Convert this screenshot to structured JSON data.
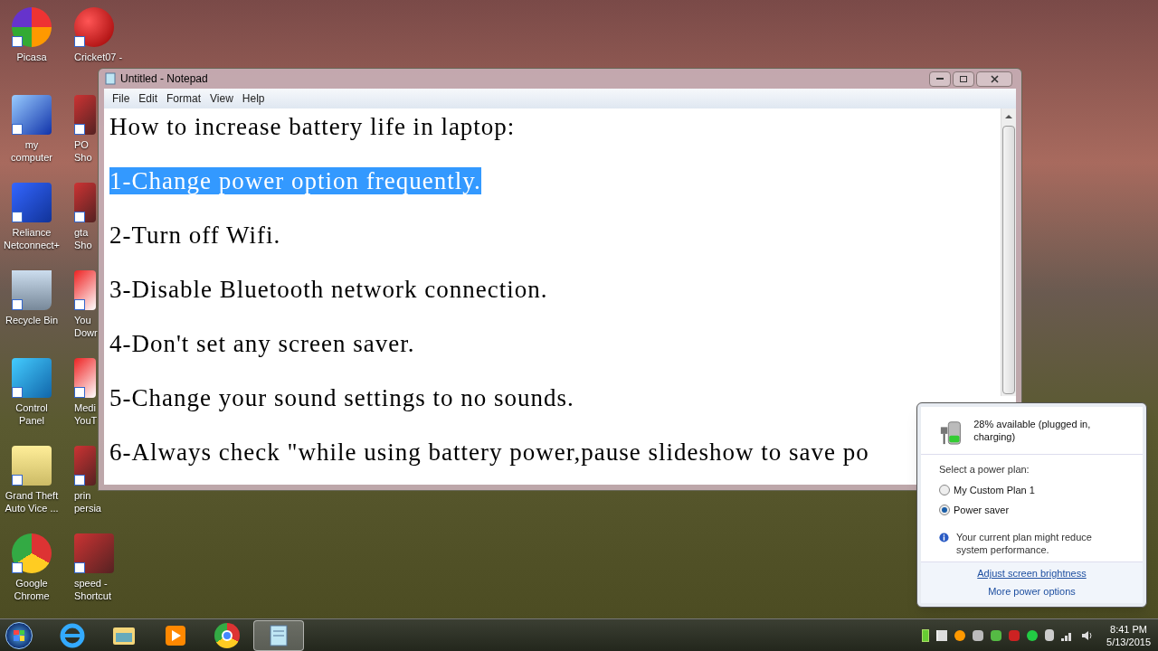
{
  "desktop": {
    "icons": [
      {
        "kind": "picasa",
        "lines": [
          "Picasa"
        ]
      },
      {
        "kind": "cricket",
        "lines": [
          "Cricket07 -"
        ]
      },
      {
        "kind": "computer",
        "lines": [
          "my",
          "computer"
        ]
      },
      {
        "kind": "game",
        "lines": [
          "PO",
          "Sho"
        ]
      },
      {
        "kind": "network",
        "lines": [
          "Reliance",
          "Netconnect+"
        ]
      },
      {
        "kind": "game",
        "lines": [
          "gta",
          "Sho"
        ]
      },
      {
        "kind": "recycle",
        "lines": [
          "Recycle Bin"
        ]
      },
      {
        "kind": "video",
        "lines": [
          "You",
          "Dowr"
        ]
      },
      {
        "kind": "control",
        "lines": [
          "Control",
          "Panel"
        ]
      },
      {
        "kind": "video",
        "lines": [
          "Medi",
          "YouT"
        ]
      },
      {
        "kind": "folder",
        "lines": [
          "Grand Theft",
          "Auto Vice ..."
        ]
      },
      {
        "kind": "game",
        "lines": [
          "prin",
          "persia"
        ]
      },
      {
        "kind": "chrome",
        "lines": [
          "Google",
          "Chrome"
        ]
      },
      {
        "kind": "game",
        "lines": [
          "speed -",
          "Shortcut"
        ]
      }
    ]
  },
  "notepad": {
    "title": "Untitled - Notepad",
    "menu": [
      "File",
      "Edit",
      "Format",
      "View",
      "Help"
    ],
    "lines": [
      {
        "text": "How to increase battery life in laptop:",
        "selected": false
      },
      {
        "text": "1-Change power option frequently.",
        "selected": true
      },
      {
        "text": "2-Turn off Wifi.",
        "selected": false
      },
      {
        "text": "3-Disable Bluetooth network connection.",
        "selected": false
      },
      {
        "text": "4-Don't set any screen saver.",
        "selected": false
      },
      {
        "text": "5-Change your sound settings to no sounds.",
        "selected": false
      },
      {
        "text": "6-Always check \"while using battery power,pause slideshow to save po",
        "selected": false
      }
    ]
  },
  "power_flyout": {
    "status": "28% available (plugged in, charging)",
    "prompt": "Select a power plan:",
    "plans": [
      {
        "label": "My Custom Plan 1",
        "selected": false
      },
      {
        "label": "Power saver",
        "selected": true
      }
    ],
    "notice": "Your current plan might reduce system performance.",
    "links": [
      "Adjust screen brightness",
      "More power options"
    ]
  },
  "taskbar": {
    "apps": [
      {
        "kind": "ie",
        "selected": false
      },
      {
        "kind": "explorer",
        "selected": false
      },
      {
        "kind": "media",
        "selected": false
      },
      {
        "kind": "chrome",
        "selected": false
      },
      {
        "kind": "notepad",
        "selected": true
      }
    ],
    "clock": {
      "time": "8:41 PM",
      "date": "5/13/2015"
    }
  }
}
